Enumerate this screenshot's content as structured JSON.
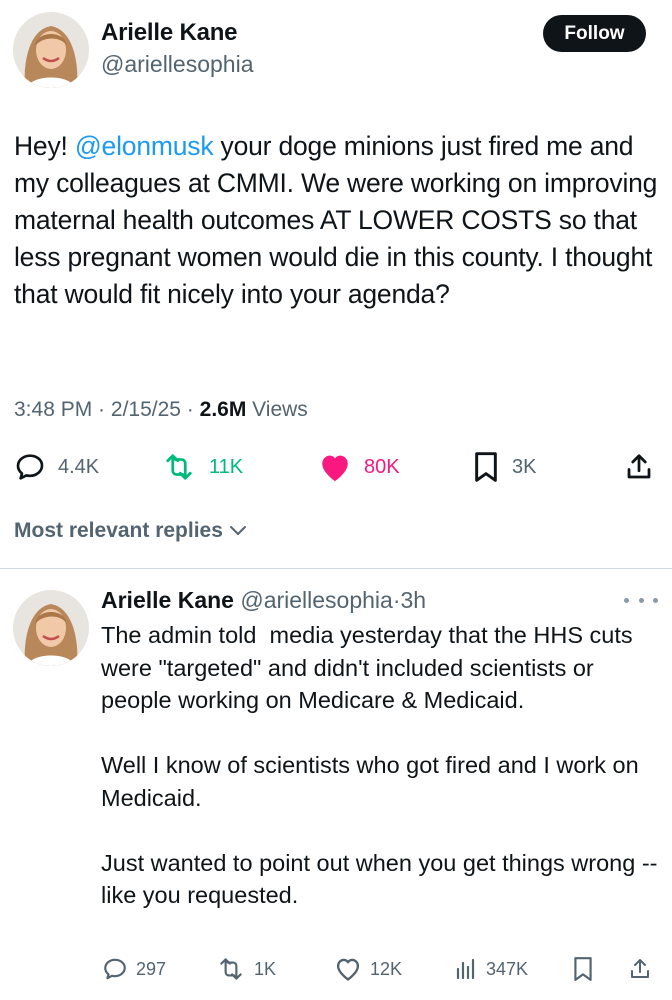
{
  "tweet": {
    "author_name": "Arielle Kane",
    "author_handle": "@ariellesophia",
    "follow_label": "Follow",
    "text_mention": "@elonmusk",
    "text_body": " your doge minions just fired me and my colleagues at CMMI. We were working on improving maternal health outcomes AT LOWER COSTS so that less pregnant women would die in this county. I thought that would fit nicely into your agenda?",
    "text_lead": "Hey! ",
    "time": "3:48 PM",
    "date": "2/15/25",
    "views_count": "2.6M",
    "views_label": "Views",
    "replies": "4.4K",
    "reposts": "11K",
    "likes": "80K",
    "bookmarks": "3K"
  },
  "sort_label": "Most relevant replies",
  "reply": {
    "author_name": "Arielle Kane",
    "author_handle": "@ariellesophia",
    "age": "3h",
    "text": "The admin told  media yesterday that the HHS cuts were \"targeted\" and didn't included scientists or people working on Medicare & Medicaid.\n\nWell I know of scientists who got fired and I work on Medicaid.\n\nJust wanted to point out when you get things wrong -- like you requested.",
    "replies": "297",
    "reposts": "1K",
    "likes": "12K",
    "views": "347K"
  },
  "colors": {
    "accent": "#1d9bf0",
    "repost": "#00ba7c",
    "like": "#f91880",
    "muted": "#536471"
  }
}
